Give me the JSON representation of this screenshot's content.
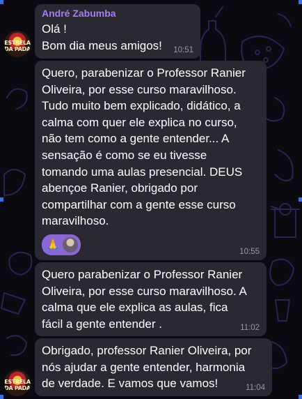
{
  "chat": {
    "sender": "André Zabumba",
    "messages": [
      {
        "text": "Olá !\nBom dia meus amigos!",
        "time": "10:51"
      },
      {
        "text": "Quero, parabenizar o Professor Ranier\nOliveira, por esse curso maravilhoso.\nTudo muito bem explicado, didático, a\ncalma com quer ele explica no curso,\nnão tem como a gente entender... A\nsensação é como se eu tivesse\ntomando uma aulas presencial. DEUS\nabençoe Ranier, obrigado por\ncompartilhar com a gente esse curso\nmaravilhoso.",
        "time": "10:55",
        "reaction": "pray-emoji"
      },
      {
        "text": "Quero parabenizar o Professor Ranier\nOliveira, por esse curso maravilhoso. A\ncalma que ele  explica as aulas, fica\nfácil a gente entender .",
        "time": "11:02"
      },
      {
        "text": "Obrigado, professor Ranier Oliveira, por\nnós ajudar a gente entender, harmonia\nde verdade. E vamos que vamos!",
        "time": "11:04"
      }
    ]
  },
  "avatar": {
    "label": "ESTRELA DA PADA"
  },
  "colors": {
    "background": "#0b0a10",
    "bubble": "#2a2830",
    "sender_name": "#a97cf2",
    "reaction_pill": "#8a66d6",
    "timestamp": "#9a97a5",
    "edge_marker": "#3a6ee8"
  }
}
